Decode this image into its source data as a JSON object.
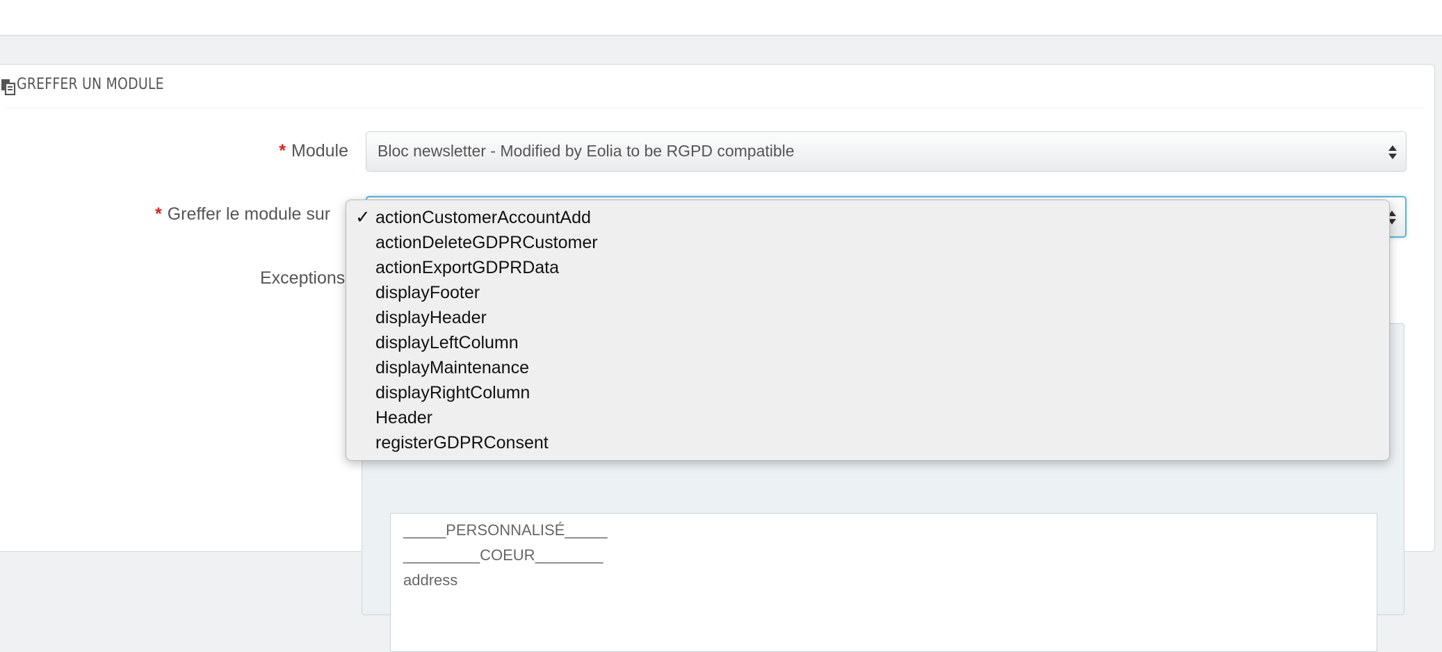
{
  "panel": {
    "title": "GREFFER UN MODULE",
    "icon": "copy-icon"
  },
  "form": {
    "required_mark": "*",
    "module_label": "Module",
    "module_value": "Bloc newsletter - Modified by Eolia to be RGPD compatible",
    "hook_label": "Greffer le module sur",
    "exceptions_label": "Exceptions"
  },
  "hook_dropdown": {
    "selected_index": 0,
    "check_glyph": "✓",
    "options": [
      "actionCustomerAccountAdd",
      "actionDeleteGDPRCustomer",
      "actionExportGDPRData",
      "displayFooter",
      "displayHeader",
      "displayLeftColumn",
      "displayMaintenance",
      "displayRightColumn",
      "Header",
      "registerGDPRConsent"
    ]
  },
  "exceptions": {
    "items": [
      "_____PERSONNALISÉ_____",
      "_________COEUR________",
      "address"
    ]
  },
  "colors": {
    "required": "#e21d1d",
    "focus_border": "#5ab4d6",
    "page_background": "#eff1f2"
  }
}
